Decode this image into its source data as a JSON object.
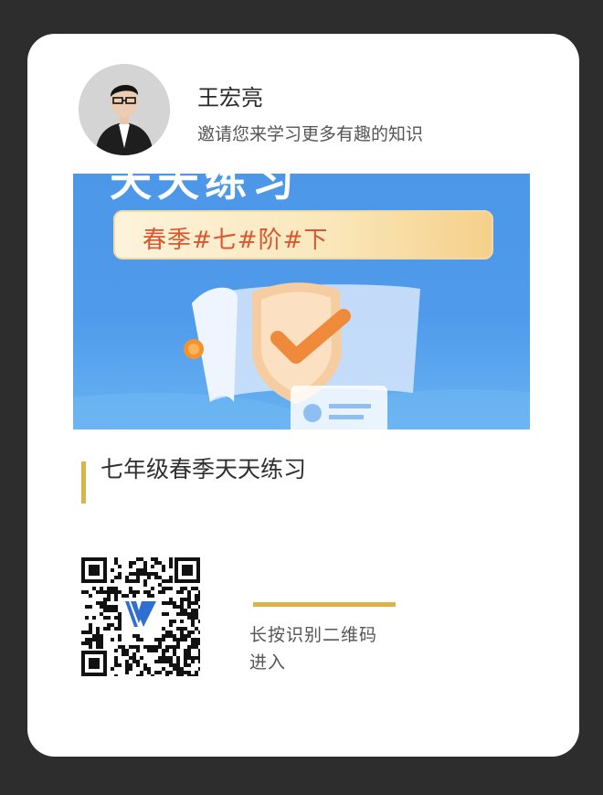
{
  "profile": {
    "name": "王宏亮",
    "invite_text": "邀请您来学习更多有趣的知识"
  },
  "banner": {
    "top_text": "天天练习",
    "tag_text": "春季#七#阶#下"
  },
  "course": {
    "title": "七年级春季天天练习"
  },
  "qr": {
    "hint_line1": "长按识别二维码",
    "hint_line2": "进入"
  },
  "colors": {
    "accent_gold": "#dcb348",
    "background": "#2d2d2d",
    "card": "#ffffff",
    "banner_blue": "#4f9aeb"
  }
}
